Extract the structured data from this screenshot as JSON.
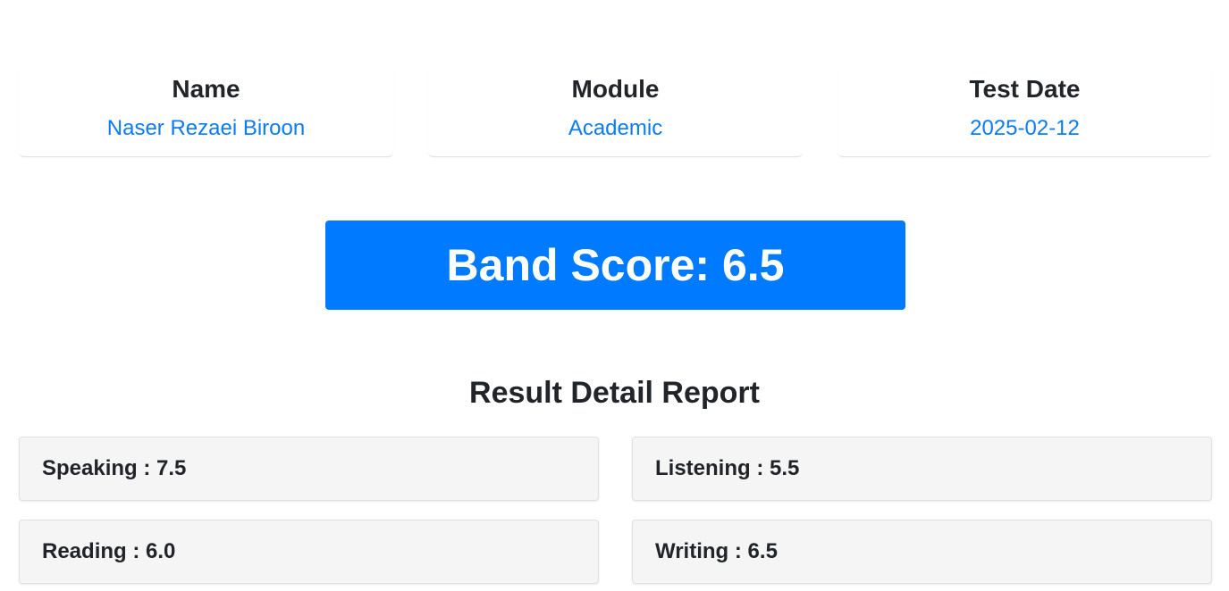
{
  "info": {
    "name_label": "Name",
    "name_value": "Naser Rezaei Biroon",
    "module_label": "Module",
    "module_value": "Academic",
    "date_label": "Test Date",
    "date_value": "2025-02-12"
  },
  "band": {
    "text": "Band Score: 6.5"
  },
  "report": {
    "title": "Result Detail Report",
    "scores": [
      {
        "label": "Speaking",
        "value": "7.5"
      },
      {
        "label": "Listening",
        "value": "5.5"
      },
      {
        "label": "Reading",
        "value": "6.0"
      },
      {
        "label": "Writing",
        "value": "6.5"
      }
    ]
  },
  "colors": {
    "accent": "#007bff",
    "link": "#0b7cf5",
    "card_bg": "#f5f5f5"
  }
}
